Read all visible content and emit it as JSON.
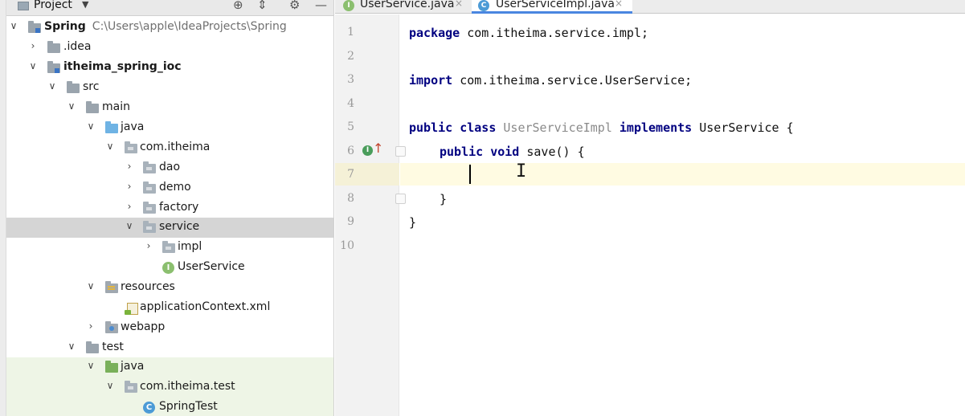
{
  "project_panel": {
    "title": "Project",
    "header_icons": [
      "globe-icon",
      "collapse-icon",
      "gear-icon",
      "minimize-icon"
    ],
    "tree": [
      {
        "label": "Spring",
        "path": "C:\\Users\\apple\\IdeaProjects\\Spring",
        "expanded": true
      },
      {
        "label": ".idea",
        "expanded": false
      },
      {
        "label": "itheima_spring_ioc",
        "expanded": true
      },
      {
        "label": "src",
        "expanded": true
      },
      {
        "label": "main",
        "expanded": true
      },
      {
        "label": "java",
        "expanded": true
      },
      {
        "label": "com.itheima",
        "expanded": true
      },
      {
        "label": "dao",
        "expanded": false
      },
      {
        "label": "demo",
        "expanded": false
      },
      {
        "label": "factory",
        "expanded": false
      },
      {
        "label": "service",
        "expanded": true,
        "selected": true
      },
      {
        "label": "impl",
        "expanded": false
      },
      {
        "label": "UserService",
        "icon": "I"
      },
      {
        "label": "resources",
        "expanded": true
      },
      {
        "label": "applicationContext.xml"
      },
      {
        "label": "webapp",
        "expanded": false
      },
      {
        "label": "test",
        "expanded": true
      },
      {
        "label": "java",
        "expanded": true
      },
      {
        "label": "com.itheima.test",
        "expanded": true
      },
      {
        "label": "SpringTest",
        "icon": "C"
      }
    ]
  },
  "tabs": [
    {
      "label": "UserService.java",
      "icon": "I",
      "active": false
    },
    {
      "label": "UserServiceImpl.java",
      "icon": "C",
      "active": true
    }
  ],
  "tab_close_glyph": "×",
  "editor": {
    "line_numbers": [
      "1",
      "2",
      "3",
      "4",
      "5",
      "6",
      "7",
      "8",
      "9",
      "10"
    ],
    "current_line": "7",
    "code": {
      "l1_kw": "package",
      "l1_rest": " com.itheima.service.impl;",
      "l3_kw": "import",
      "l3_rest": " com.itheima.service.UserService;",
      "l5_kw1": "public class",
      "l5_name": " UserServiceImpl ",
      "l5_kw2": "implements",
      "l5_rest": " UserService {",
      "l6_kw": "public void",
      "l6_rest": " save() {",
      "l8": "}",
      "l9": "}"
    },
    "gutter_marker": "I",
    "gutter_arrow": "↑",
    "mouse_cursor": "I"
  },
  "colors": {
    "keyword": "#000080",
    "selection": "#d5d5d5",
    "current_line": "#fffbe2",
    "test_tree_bg": "#eef5e6",
    "tab_accent": "#4a86e0"
  }
}
